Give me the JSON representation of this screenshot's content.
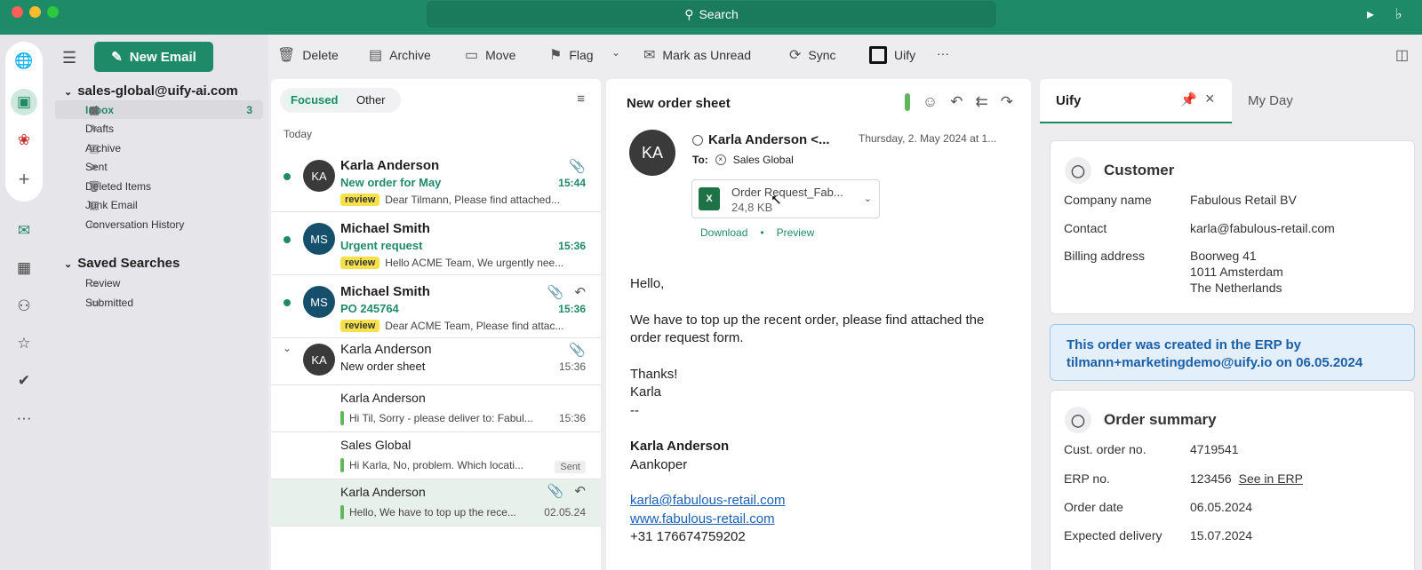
{
  "titlebar": {
    "search_label": "Search"
  },
  "toolbar": {
    "new_email": "New Email",
    "delete": "Delete",
    "archive": "Archive",
    "move": "Move",
    "flag": "Flag",
    "mark_unread": "Mark as Unread",
    "sync": "Sync",
    "uify": "Uify",
    "more": "···"
  },
  "folders": {
    "account": "sales-global@uify-ai.com",
    "items": [
      {
        "label": "Inbox",
        "count": "3"
      },
      {
        "label": "Drafts"
      },
      {
        "label": "Archive"
      },
      {
        "label": "Sent"
      },
      {
        "label": "Deleted Items"
      },
      {
        "label": "Junk Email"
      },
      {
        "label": "Conversation History"
      }
    ],
    "saved_title": "Saved Searches",
    "saved": [
      {
        "label": "Review"
      },
      {
        "label": "Submitted"
      }
    ]
  },
  "list": {
    "tab_focused": "Focused",
    "tab_other": "Other",
    "group": "Today",
    "messages": [
      {
        "initials": "KA",
        "sender": "Karla Anderson",
        "subject": "New order for May",
        "time": "15:44",
        "tag": "review",
        "preview": "Dear Tilmann, Please find attached..."
      },
      {
        "initials": "MS",
        "sender": "Michael Smith",
        "subject": "Urgent request",
        "time": "15:36",
        "tag": "review",
        "preview": "Hello ACME Team, We urgently nee..."
      },
      {
        "initials": "MS",
        "sender": "Michael Smith",
        "subject": "PO 245764",
        "time": "15:36",
        "tag": "review",
        "preview": "Dear ACME Team, Please find attac..."
      },
      {
        "initials": "KA",
        "sender": "Karla Anderson",
        "subject": "New order sheet",
        "time": "15:36"
      },
      {
        "sender": "Karla Anderson",
        "time": "15:36",
        "preview": "Hi Til, Sorry - please deliver to: Fabul..."
      },
      {
        "sender": "Sales Global",
        "preview": "Hi Karla, No, problem. Which locati...",
        "badge": "Sent"
      },
      {
        "sender": "Karla Anderson",
        "time": "02.05.24",
        "preview": "Hello, We have to top up the rece..."
      }
    ]
  },
  "reading": {
    "subject": "New order sheet",
    "initials": "KA",
    "from": "Karla Anderson <...",
    "date": "Thursday, 2. May 2024 at 1...",
    "to_label": "To:",
    "to": "Sales Global",
    "attachment_name": "Order Request_Fab...",
    "attachment_size": "24,8 KB",
    "attachment_type": "X",
    "download": "Download",
    "sep": "•",
    "preview": "Preview",
    "greeting": "Hello,",
    "para1": "We have to top up the recent order, please find attached the order request form.",
    "thanks": "Thanks!",
    "name_short": "Karla",
    "dashes": "--",
    "sig_name": "Karla Anderson",
    "sig_title": "Aankoper",
    "sig_email": "karla@fabulous-retail.com",
    "sig_web": "www.fabulous-retail.com",
    "sig_phone": "+31 176674759202"
  },
  "side": {
    "tab_uify": "Uify",
    "tab_myday": "My Day",
    "customer": {
      "title": "Customer",
      "company_label": "Company name",
      "company": "Fabulous Retail BV",
      "contact_label": "Contact",
      "contact": "karla@fabulous-retail.com",
      "billing_label": "Billing address",
      "billing1": "Boorweg 41",
      "billing2": "1011 Amsterdam",
      "billing3": "The Netherlands"
    },
    "info": "This order was created in the ERP by tilmann+marketingdemo@uify.io on 06.05.2024",
    "order": {
      "title": "Order summary",
      "cust_label": "Cust. order no.",
      "cust": "4719541",
      "erp_label": "ERP no.",
      "erp": "123456",
      "erp_link": "See in ERP",
      "date_label": "Order date",
      "date": "06.05.2024",
      "delivery_label": "Expected delivery",
      "delivery": "15.07.2024"
    }
  },
  "colors": {
    "accent": "#1f8a68",
    "tag": "#f6e14c",
    "info": "#e3f0fb"
  }
}
